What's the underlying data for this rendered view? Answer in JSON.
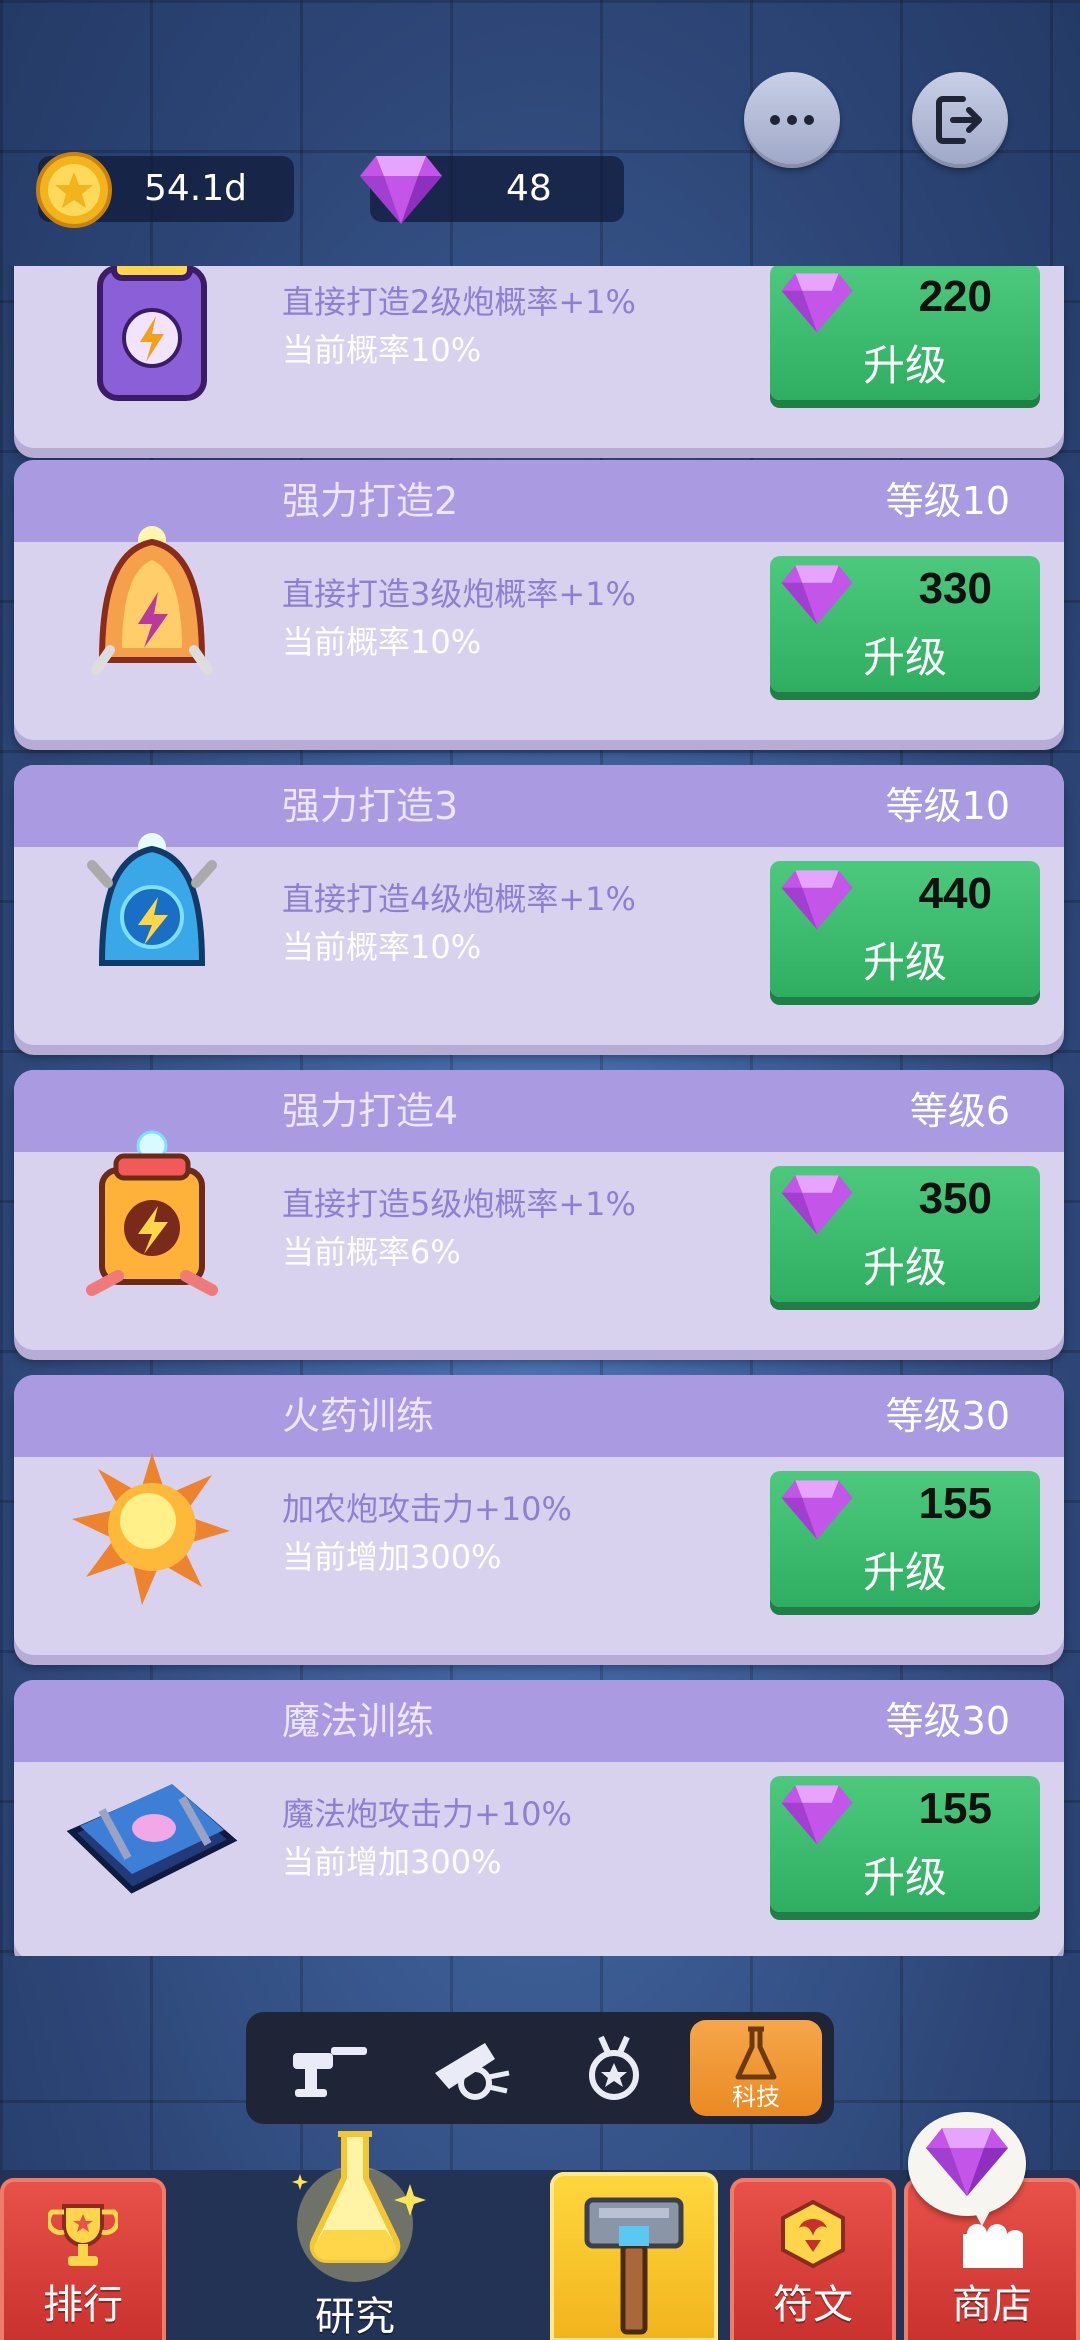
{
  "header": {
    "more_icon": "ellipsis-icon",
    "exit_icon": "exit-icon",
    "gold": "54.1d",
    "gems": "48"
  },
  "cards": [
    {
      "title": "",
      "level": "",
      "desc": "直接打造2级炮概率+1%",
      "current": "当前概率10%",
      "cost": "220",
      "button": "升级",
      "icon": "battery-purple-icon"
    },
    {
      "title": "强力打造2",
      "level": "等级10",
      "desc": "直接打造3级炮概率+1%",
      "current": "当前概率10%",
      "cost": "330",
      "button": "升级",
      "icon": "bell-orange-icon"
    },
    {
      "title": "强力打造3",
      "level": "等级10",
      "desc": "直接打造4级炮概率+1%",
      "current": "当前概率10%",
      "cost": "440",
      "button": "升级",
      "icon": "bell-blue-icon"
    },
    {
      "title": "强力打造4",
      "level": "等级6",
      "desc": "直接打造5级炮概率+1%",
      "current": "当前概率6%",
      "cost": "350",
      "button": "升级",
      "icon": "battery-orange-icon"
    },
    {
      "title": "火药训练",
      "level": "等级30",
      "desc": "加农炮攻击力+10%",
      "current": "当前增加300%",
      "cost": "155",
      "button": "升级",
      "icon": "explosion-icon"
    },
    {
      "title": "魔法训练",
      "level": "等级30",
      "desc": "魔法炮攻击力+10%",
      "current": "当前增加300%",
      "cost": "155",
      "button": "升级",
      "icon": "spellbook-icon"
    }
  ],
  "sub_tabs": [
    {
      "icon": "turret-icon",
      "label": ""
    },
    {
      "icon": "cannon-icon",
      "label": ""
    },
    {
      "icon": "medal-icon",
      "label": ""
    },
    {
      "icon": "flask-icon",
      "label": "科技"
    }
  ],
  "bottom_nav": {
    "rank": "排行",
    "research": "研究",
    "forge_icon": "hammer-icon",
    "rune": "符文",
    "shop": "商店"
  },
  "colors": {
    "card_bg": "#d9d2ee",
    "card_header": "#a99ae2",
    "button_green": "#3bbc6f",
    "active_tab": "#f29a35",
    "nav_red": "#d7403a",
    "nav_yellow": "#f7c52b"
  }
}
